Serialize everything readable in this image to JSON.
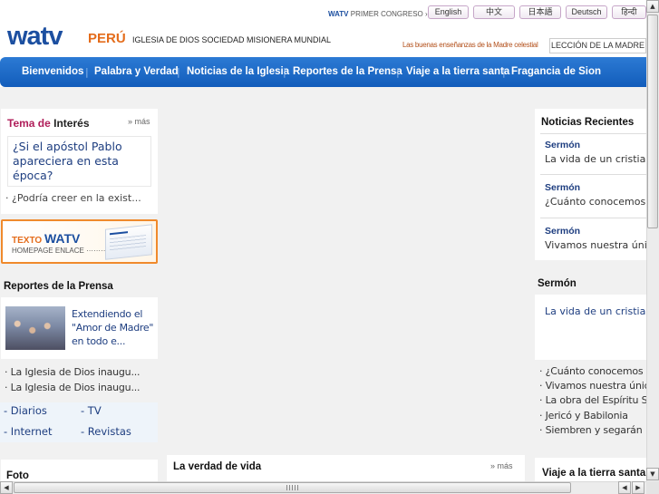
{
  "header": {
    "logo": "watv",
    "country": "PERÚ",
    "org_name": "IGLESIA DE DIOS SOCIEDAD MISIONERA MUNDIAL",
    "congreso_brand": "WATV",
    "congreso_label": "PRIMER CONGRESO",
    "languages": [
      "English",
      "中文",
      "日本語",
      "Deutsch",
      "हिन्दी"
    ],
    "tagline": "Las buenas enseñanzas de la Madre celestial",
    "leccion": "LECCIÓN DE LA MADRE"
  },
  "nav": [
    "Bienvenidos",
    "Palabra y Verdad",
    "Noticias de la Iglesia",
    "Reportes de la Prensa",
    "Viaje a la tierra santa",
    "Fragancia de Sion"
  ],
  "left": {
    "tema": {
      "accent": "Tema de",
      "rest": "Interés",
      "more": "» más",
      "feature": "¿Si el apóstol Pablo apareciera en esta época?",
      "sub": "· ¿Podría creer en la exist..."
    },
    "banner": {
      "small": "TEXTO",
      "big": "WATV",
      "line2": "HOMEPAGE ENLACE ··········"
    },
    "press": {
      "title": "Reportes de la Prensa",
      "feature": "Extendiendo el \"Amor de Madre\" en todo e...",
      "items": [
        "· La Iglesia de Dios inaugu...",
        "· La Iglesia de Dios inaugu..."
      ],
      "media": [
        "- Diarios",
        "- TV",
        "- Internet",
        "- Revistas"
      ]
    },
    "foto": "Foto"
  },
  "center": {
    "title": "La verdad de vida",
    "more": "» más"
  },
  "right": {
    "news": {
      "title": "Noticias Recientes",
      "items": [
        {
          "cat": "Sermón",
          "text": "La vida de un cristiano"
        },
        {
          "cat": "Sermón",
          "text": "¿Cuánto conocemos d"
        },
        {
          "cat": "Sermón",
          "text": "Vivamos nuestra única"
        }
      ]
    },
    "sermon": {
      "title": "Sermón",
      "feature": "La vida de un cristiano",
      "items": [
        "· ¿Cuánto conocemos d",
        "· Vivamos nuestra única",
        "· La obra del Espíritu San",
        "· Jericó y Babilonia",
        "· Siembren y segarán"
      ]
    },
    "viaje": "Viaje a la tierra santa"
  },
  "scroll": {
    "up": "▲",
    "down": "▼",
    "left": "◀",
    "right": "▶"
  }
}
